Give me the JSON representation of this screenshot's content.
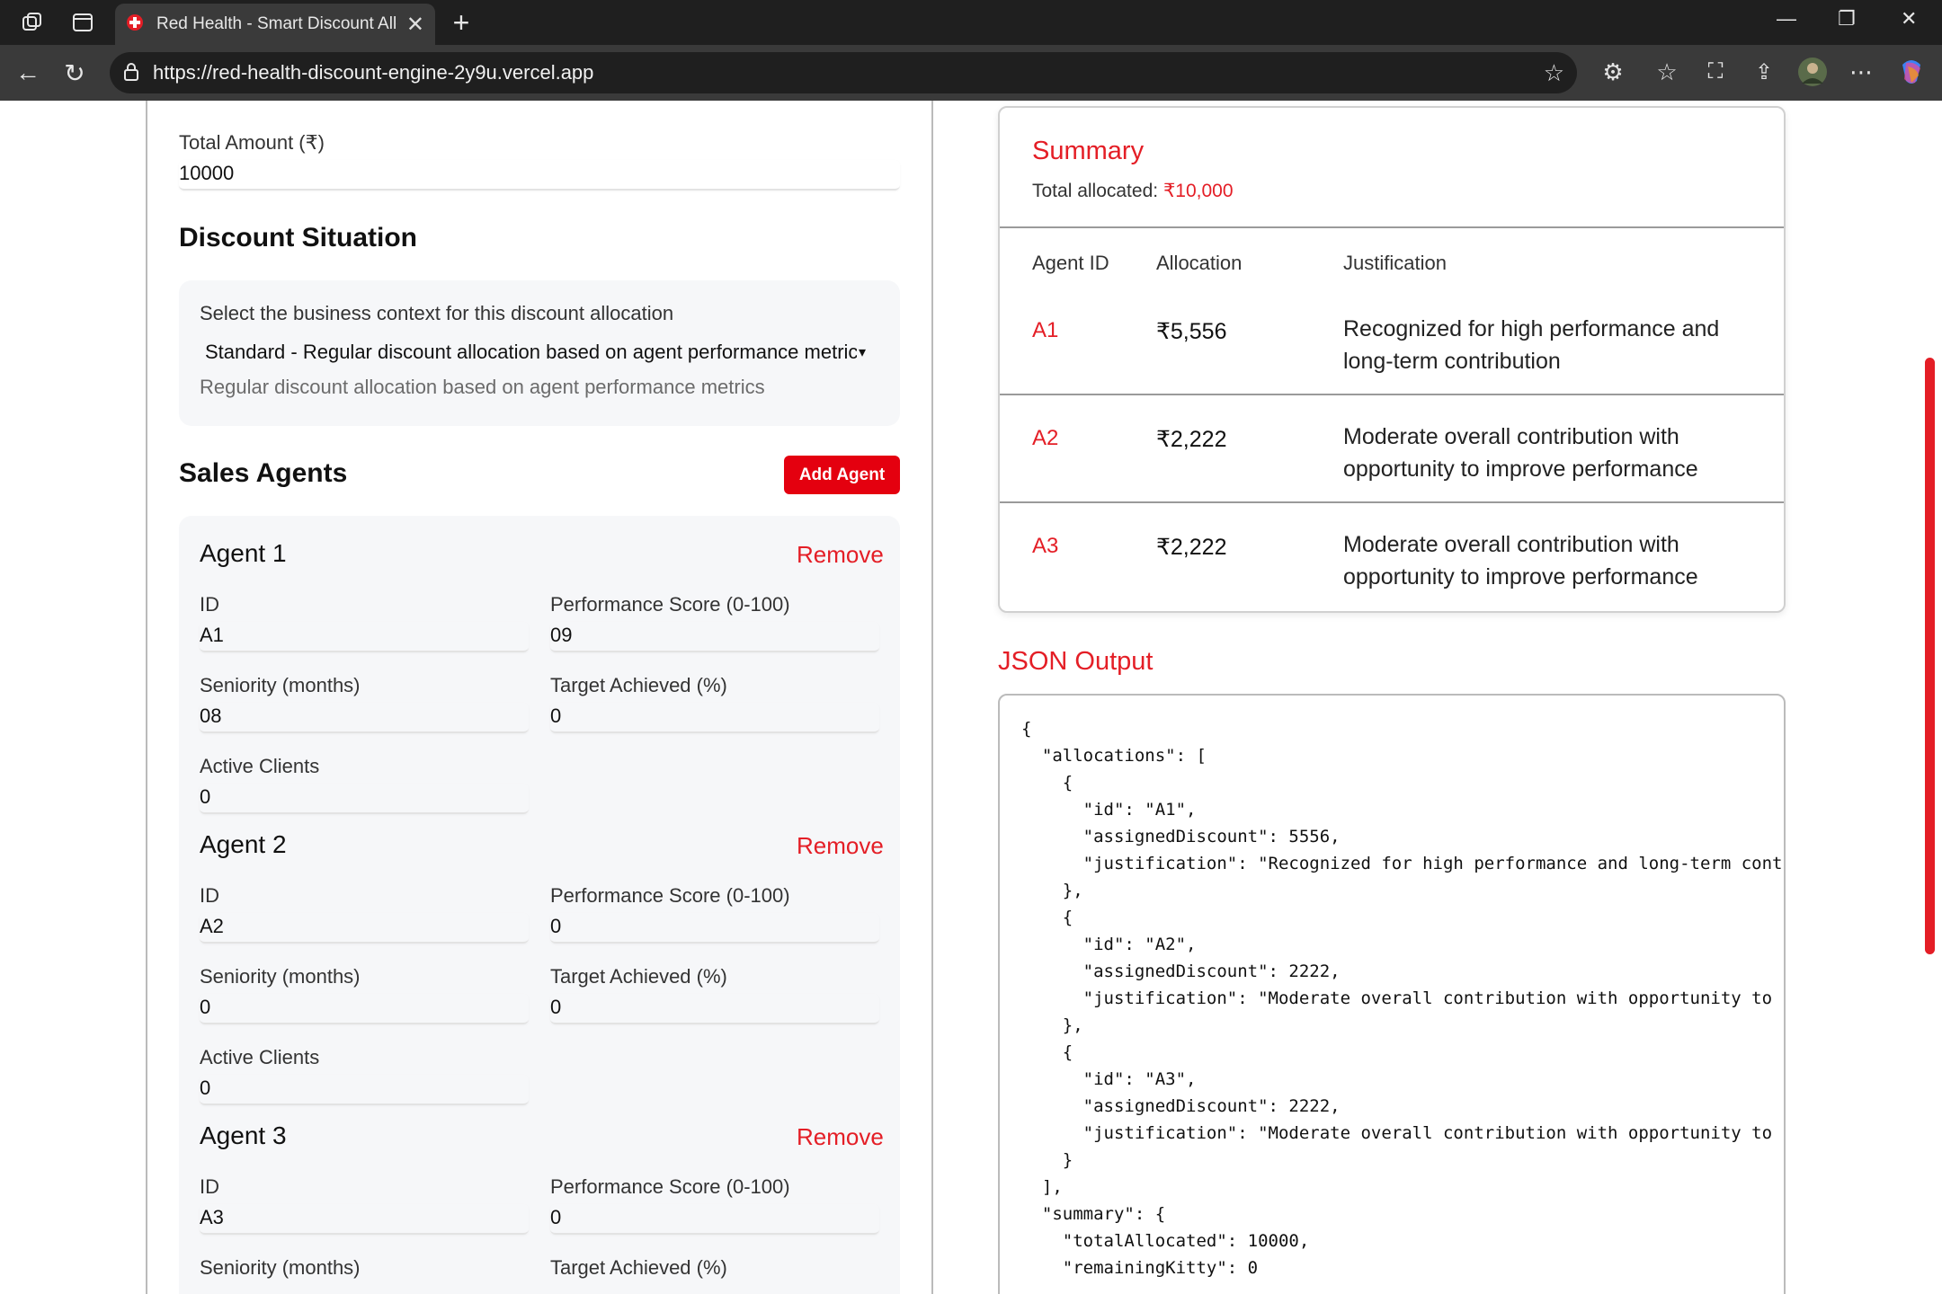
{
  "browser": {
    "tab_title": "Red Health - Smart Discount Allocation",
    "url": "https://red-health-discount-engine-2y9u.vercel.app"
  },
  "form": {
    "total_amount_label": "Total Amount (₹)",
    "total_amount_value": "10000",
    "discount_heading": "Discount Situation",
    "context_label": "Select the business context for this discount allocation",
    "context_selected": "Standard - Regular discount allocation based on agent performance metrics",
    "context_description": "Regular discount allocation based on agent performance metrics",
    "agents_heading": "Sales Agents",
    "add_agent_label": "Add Agent",
    "remove_label": "Remove",
    "labels": {
      "id": "ID",
      "performance": "Performance Score (0-100)",
      "seniority": "Seniority (months)",
      "target": "Target Achieved (%)",
      "clients": "Active Clients"
    },
    "agents": [
      {
        "title": "Agent 1",
        "id": "A1",
        "performance": "09",
        "seniority": "08",
        "target": "0",
        "clients": "0"
      },
      {
        "title": "Agent 2",
        "id": "A2",
        "performance": "0",
        "seniority": "0",
        "target": "0",
        "clients": "0"
      },
      {
        "title": "Agent 3",
        "id": "A3",
        "performance": "0"
      }
    ]
  },
  "summary": {
    "title": "Summary",
    "total_label": "Total allocated:",
    "total_value": "₹10,000",
    "headers": [
      "Agent ID",
      "Allocation",
      "Justification"
    ],
    "rows": [
      {
        "id": "A1",
        "amount": "₹5,556",
        "justification": "Recognized for high performance and long-term contribution"
      },
      {
        "id": "A2",
        "amount": "₹2,222",
        "justification": "Moderate overall contribution with opportunity to improve performance"
      },
      {
        "id": "A3",
        "amount": "₹2,222",
        "justification": "Moderate overall contribution with opportunity to improve performance"
      }
    ]
  },
  "json_output": {
    "title": "JSON Output",
    "text": "{\n  \"allocations\": [\n    {\n      \"id\": \"A1\",\n      \"assignedDiscount\": 5556,\n      \"justification\": \"Recognized for high performance and long-term cont\n    },\n    {\n      \"id\": \"A2\",\n      \"assignedDiscount\": 2222,\n      \"justification\": \"Moderate overall contribution with opportunity to\n    },\n    {\n      \"id\": \"A3\",\n      \"assignedDiscount\": 2222,\n      \"justification\": \"Moderate overall contribution with opportunity to\n    }\n  ],\n  \"summary\": {\n    \"totalAllocated\": 10000,\n    \"remainingKitty\": 0"
  },
  "colors": {
    "accent": "#e41e26",
    "button": "#e4000f"
  }
}
